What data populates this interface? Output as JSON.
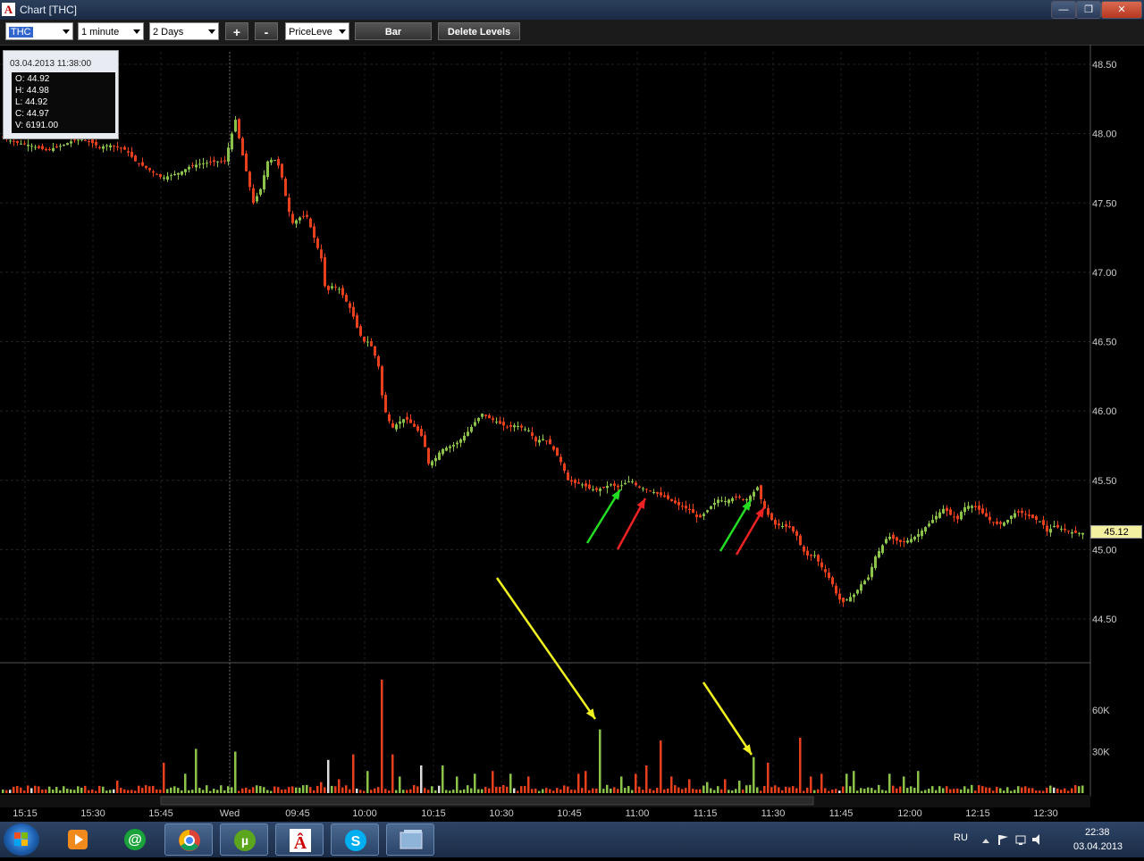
{
  "window": {
    "title": "Chart [THC]",
    "app_icon_letter": "A",
    "minimize_label": "—",
    "restore_label": "❐",
    "close_label": "✕"
  },
  "toolbar": {
    "symbol": "THC",
    "interval": "1 minute",
    "range": "2 Days",
    "zoom_in_label": "+",
    "zoom_out_label": "-",
    "study": "PriceLeve",
    "bar_label": "Bar",
    "delete_levels_label": "Delete Levels"
  },
  "tooltip": {
    "timestamp": "03.04.2013 11:38:00",
    "open": "O: 44.92",
    "high": "H: 44.98",
    "low": "L: 44.92",
    "close": "C: 44.97",
    "volume": "V: 6191.00"
  },
  "chart_data": {
    "type": "candlestick",
    "price_axis": {
      "ticks": [
        "48.50",
        "48.00",
        "47.50",
        "47.00",
        "46.50",
        "46.00",
        "45.50",
        "45.00",
        "44.50"
      ],
      "min": 44.15,
      "max": 48.62
    },
    "last_price": "45.12",
    "volume_axis": {
      "ticks": [
        "60K",
        "30K"
      ],
      "max": 90000
    },
    "time_labels": [
      "15:15",
      "15:30",
      "15:45",
      "Wed",
      "09:45",
      "10:00",
      "10:15",
      "10:30",
      "10:45",
      "11:00",
      "11:15",
      "11:30",
      "11:45",
      "12:00",
      "12:15",
      "12:30"
    ],
    "price_path": [
      [
        0,
        47.98
      ],
      [
        10,
        47.95
      ],
      [
        20,
        47.93
      ],
      [
        30,
        47.92
      ],
      [
        40,
        47.9
      ],
      [
        50,
        47.88
      ],
      [
        60,
        47.9
      ],
      [
        70,
        47.92
      ],
      [
        80,
        47.95
      ],
      [
        90,
        47.96
      ],
      [
        100,
        47.94
      ],
      [
        110,
        47.9
      ],
      [
        120,
        47.92
      ],
      [
        130,
        47.9
      ],
      [
        140,
        47.88
      ],
      [
        150,
        47.8
      ],
      [
        160,
        47.76
      ],
      [
        170,
        47.72
      ],
      [
        180,
        47.68
      ],
      [
        190,
        47.7
      ],
      [
        200,
        47.72
      ],
      [
        210,
        47.76
      ],
      [
        220,
        47.78
      ],
      [
        230,
        47.79
      ],
      [
        240,
        47.8
      ],
      [
        250,
        47.8
      ],
      [
        262,
        48.1
      ],
      [
        268,
        47.9
      ],
      [
        275,
        47.7
      ],
      [
        282,
        47.5
      ],
      [
        290,
        47.6
      ],
      [
        298,
        47.8
      ],
      [
        305,
        47.82
      ],
      [
        312,
        47.75
      ],
      [
        318,
        47.55
      ],
      [
        325,
        47.35
      ],
      [
        335,
        47.4
      ],
      [
        342,
        47.4
      ],
      [
        350,
        47.25
      ],
      [
        358,
        47.1
      ],
      [
        363,
        46.85
      ],
      [
        370,
        46.9
      ],
      [
        378,
        46.88
      ],
      [
        385,
        46.8
      ],
      [
        392,
        46.72
      ],
      [
        398,
        46.6
      ],
      [
        405,
        46.5
      ],
      [
        412,
        46.5
      ],
      [
        418,
        46.4
      ],
      [
        423,
        46.3
      ],
      [
        427,
        46.05
      ],
      [
        432,
        45.95
      ],
      [
        438,
        45.88
      ],
      [
        445,
        45.92
      ],
      [
        452,
        45.95
      ],
      [
        460,
        45.9
      ],
      [
        467,
        45.85
      ],
      [
        472,
        45.8
      ],
      [
        478,
        45.62
      ],
      [
        485,
        45.65
      ],
      [
        492,
        45.72
      ],
      [
        500,
        45.74
      ],
      [
        508,
        45.76
      ],
      [
        515,
        45.8
      ],
      [
        522,
        45.85
      ],
      [
        530,
        45.92
      ],
      [
        538,
        45.98
      ],
      [
        545,
        45.95
      ],
      [
        552,
        45.93
      ],
      [
        560,
        45.9
      ],
      [
        568,
        45.88
      ],
      [
        575,
        45.9
      ],
      [
        582,
        45.88
      ],
      [
        590,
        45.86
      ],
      [
        598,
        45.78
      ],
      [
        605,
        45.8
      ],
      [
        612,
        45.78
      ],
      [
        620,
        45.7
      ],
      [
        627,
        45.62
      ],
      [
        634,
        45.5
      ],
      [
        642,
        45.48
      ],
      [
        650,
        45.47
      ],
      [
        658,
        45.44
      ],
      [
        666,
        45.43
      ],
      [
        674,
        45.45
      ],
      [
        682,
        45.47
      ],
      [
        690,
        45.45
      ],
      [
        698,
        45.48
      ],
      [
        705,
        45.5
      ],
      [
        712,
        45.45
      ],
      [
        720,
        45.44
      ],
      [
        728,
        45.42
      ],
      [
        735,
        45.4
      ],
      [
        742,
        45.38
      ],
      [
        750,
        45.35
      ],
      [
        758,
        45.32
      ],
      [
        765,
        45.3
      ],
      [
        772,
        45.28
      ],
      [
        780,
        45.22
      ],
      [
        788,
        45.27
      ],
      [
        795,
        45.32
      ],
      [
        802,
        45.36
      ],
      [
        810,
        45.35
      ],
      [
        818,
        45.37
      ],
      [
        825,
        45.38
      ],
      [
        832,
        45.35
      ],
      [
        840,
        45.4
      ],
      [
        846,
        45.45
      ],
      [
        852,
        45.32
      ],
      [
        858,
        45.25
      ],
      [
        866,
        45.18
      ],
      [
        874,
        45.17
      ],
      [
        882,
        45.16
      ],
      [
        890,
        45.1
      ],
      [
        896,
        45.0
      ],
      [
        903,
        44.95
      ],
      [
        910,
        44.96
      ],
      [
        917,
        44.88
      ],
      [
        924,
        44.82
      ],
      [
        930,
        44.75
      ],
      [
        936,
        44.65
      ],
      [
        942,
        44.62
      ],
      [
        948,
        44.65
      ],
      [
        955,
        44.68
      ],
      [
        962,
        44.75
      ],
      [
        970,
        44.8
      ],
      [
        978,
        44.95
      ],
      [
        985,
        45.02
      ],
      [
        992,
        45.1
      ],
      [
        1000,
        45.07
      ],
      [
        1008,
        45.05
      ],
      [
        1016,
        45.07
      ],
      [
        1024,
        45.1
      ],
      [
        1032,
        45.15
      ],
      [
        1040,
        45.2
      ],
      [
        1047,
        45.25
      ],
      [
        1055,
        45.3
      ],
      [
        1062,
        45.25
      ],
      [
        1070,
        45.22
      ],
      [
        1076,
        45.3
      ],
      [
        1084,
        45.32
      ],
      [
        1092,
        45.3
      ],
      [
        1100,
        45.25
      ],
      [
        1108,
        45.2
      ],
      [
        1116,
        45.18
      ],
      [
        1124,
        45.2
      ],
      [
        1132,
        45.26
      ],
      [
        1140,
        45.27
      ],
      [
        1148,
        45.25
      ],
      [
        1156,
        45.22
      ],
      [
        1164,
        45.2
      ],
      [
        1170,
        45.13
      ],
      [
        1178,
        45.17
      ],
      [
        1186,
        45.15
      ],
      [
        1194,
        45.13
      ],
      [
        1202,
        45.12
      ],
      [
        1210,
        45.12
      ]
    ],
    "volume_spikes": [
      [
        40,
        6000
      ],
      [
        70,
        5000
      ],
      [
        100,
        6000
      ],
      [
        130,
        9000
      ],
      [
        160,
        7000
      ],
      [
        182,
        22000
      ],
      [
        205,
        14000
      ],
      [
        218,
        32000
      ],
      [
        232,
        15000
      ],
      [
        248,
        28000
      ],
      [
        263,
        30000
      ],
      [
        280,
        12000
      ],
      [
        300,
        10000
      ],
      [
        320,
        12000
      ],
      [
        340,
        9000
      ],
      [
        358,
        8000
      ],
      [
        365,
        24000
      ],
      [
        378,
        10000
      ],
      [
        395,
        28000
      ],
      [
        410,
        16000
      ],
      [
        420,
        15000
      ],
      [
        427,
        82000
      ],
      [
        432,
        58000
      ],
      [
        437,
        28000
      ],
      [
        445,
        12000
      ],
      [
        460,
        18000
      ],
      [
        470,
        20000
      ],
      [
        480,
        16000
      ],
      [
        495,
        20000
      ],
      [
        510,
        12000
      ],
      [
        530,
        14000
      ],
      [
        550,
        16000
      ],
      [
        570,
        14000
      ],
      [
        590,
        12000
      ],
      [
        600,
        24000
      ],
      [
        612,
        22000
      ],
      [
        620,
        32000
      ],
      [
        632,
        18000
      ],
      [
        645,
        14000
      ],
      [
        655,
        16000
      ],
      [
        670,
        46000
      ],
      [
        680,
        10000
      ],
      [
        695,
        12000
      ],
      [
        710,
        14000
      ],
      [
        722,
        20000
      ],
      [
        737,
        38000
      ],
      [
        750,
        12000
      ],
      [
        770,
        10000
      ],
      [
        790,
        8000
      ],
      [
        810,
        10000
      ],
      [
        825,
        9000
      ],
      [
        836,
        8000
      ],
      [
        843,
        26000
      ],
      [
        858,
        22000
      ],
      [
        872,
        10000
      ],
      [
        893,
        40000
      ],
      [
        905,
        12000
      ],
      [
        918,
        14000
      ],
      [
        932,
        18000
      ],
      [
        945,
        14000
      ],
      [
        955,
        16000
      ],
      [
        968,
        58000
      ],
      [
        980,
        18000
      ],
      [
        995,
        14000
      ],
      [
        1010,
        12000
      ],
      [
        1025,
        16000
      ],
      [
        1040,
        14000
      ],
      [
        1060,
        12000
      ],
      [
        1080,
        10000
      ],
      [
        1100,
        9000
      ],
      [
        1120,
        8000
      ],
      [
        1140,
        7000
      ],
      [
        1160,
        6000
      ],
      [
        1188,
        10000
      ],
      [
        1205,
        5000
      ]
    ],
    "colors": {
      "up": "#8bc34a",
      "down": "#e8401c",
      "arrow_green": "#22dd22",
      "arrow_red": "#ee2222",
      "arrow_yellow": "#f0f020"
    }
  },
  "taskbar": {
    "language": "RU",
    "time": "22:38",
    "date": "03.04.2013"
  }
}
